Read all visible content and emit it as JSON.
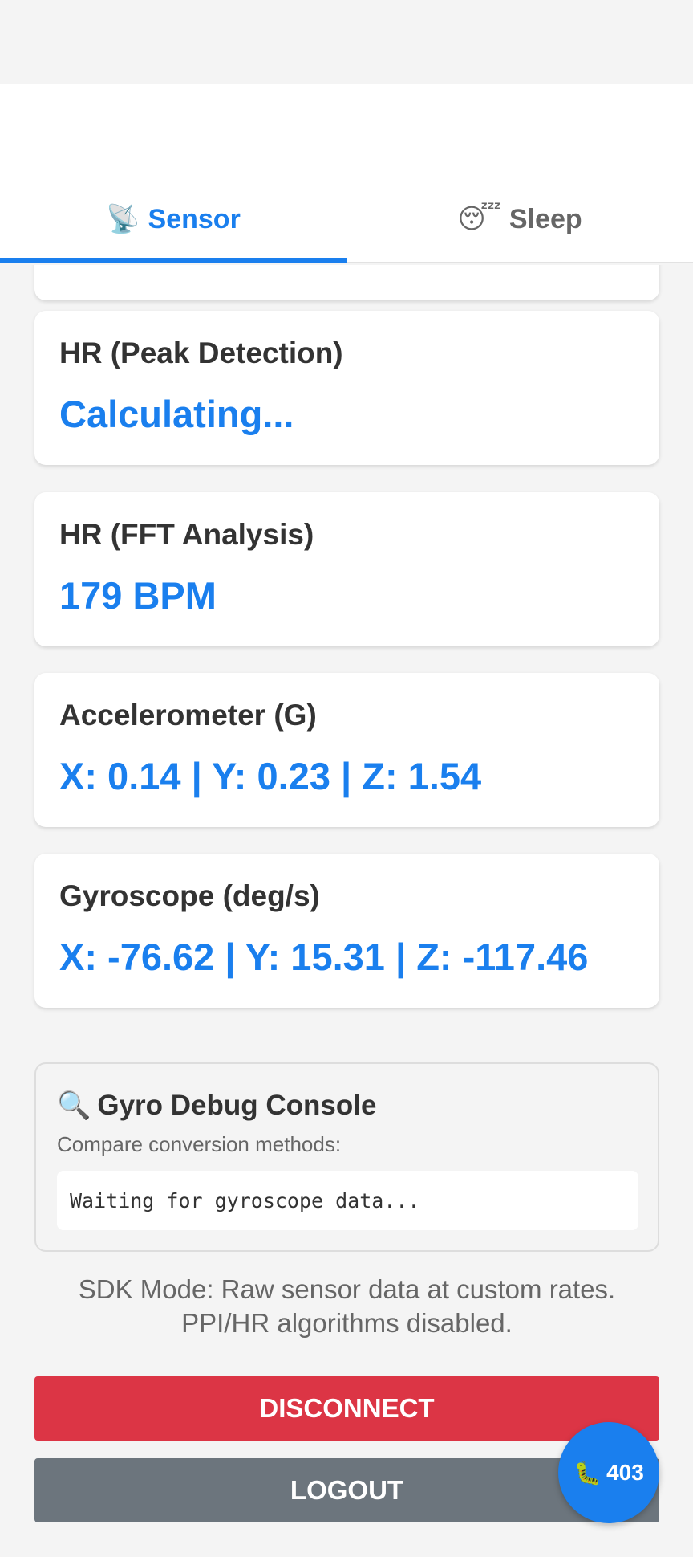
{
  "tabs": [
    {
      "icon": "satellite-antenna-icon",
      "emoji": "📡",
      "label": "Sensor",
      "active": true
    },
    {
      "icon": "sleeping-face-icon",
      "emoji": "😴",
      "label": "Sleep",
      "active": false
    }
  ],
  "cards": [
    {
      "label": "HR (Peak Detection)",
      "value": "Calculating..."
    },
    {
      "label": "HR (FFT Analysis)",
      "value": "179 BPM"
    },
    {
      "label": "Accelerometer (G)",
      "value": "X: 0.14 | Y: 0.23 | Z: 1.54"
    },
    {
      "label": "Gyroscope (deg/s)",
      "value": "X: -76.62 | Y: 15.31 | Z: -117.46"
    }
  ],
  "debug_console": {
    "icon": "magnifier-icon",
    "emoji": "🔍",
    "title": "Gyro Debug Console",
    "subtitle": "Compare conversion methods:",
    "output": "Waiting for gyroscope data..."
  },
  "note": "SDK Mode: Raw sensor data at custom rates. PPI/HR algorithms disabled.",
  "buttons": {
    "disconnect": "DISCONNECT",
    "logout": "LOGOUT"
  },
  "fab": {
    "icon": "bug-icon",
    "emoji": "🐛",
    "count": "403"
  },
  "colors": {
    "accent": "#1a7fee",
    "danger": "#dc3545",
    "secondary": "#6c757d",
    "background": "#f4f4f4"
  }
}
